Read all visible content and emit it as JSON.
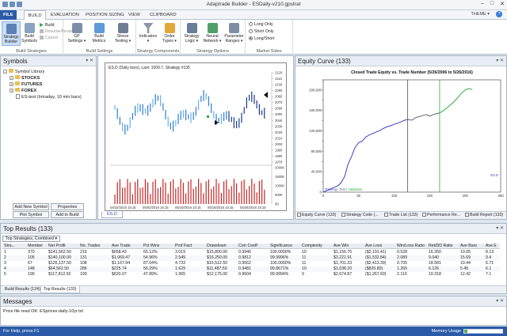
{
  "window": {
    "title": "Adaptrade Builder - ESDaily-v210.gpstrat",
    "theme_label": "THEME",
    "help": "?",
    "controls": [
      "–",
      "□",
      "✕"
    ]
  },
  "ribbon_tabs": [
    "FILE",
    "BUILD",
    "EVALUATION",
    "POSITION SIZING",
    "VIEW",
    "CLIPBOARD"
  ],
  "ribbon": {
    "strategy_builder": "Strategy Builder",
    "build_symbols": "Build Symbols",
    "build": "Build",
    "resume": "Resume/Iterate",
    "cancel": "Cancel",
    "group_build": "Build Strategies",
    "gp_settings": "GP Settings",
    "build_metrics": "Build Metrics",
    "stress_testing": "Stress Testing",
    "group_settings": "Build Settings",
    "indicators": "Indicators",
    "order_types": "Order Types",
    "group_components": "Strategy Components",
    "strategy_logic": "Strategy Logic",
    "neural_network": "Neural Network",
    "parameter_ranges": "Parameter Ranges",
    "group_options": "Strategy Options",
    "long_only": "Long Only",
    "short_only": "Short Only",
    "long_short": "Long/Short",
    "group_market": "Market Sides"
  },
  "symbols": {
    "title": "Symbols",
    "tree": [
      {
        "label": "Symbol Library",
        "kind": "folder",
        "level": 0,
        "exp": "-"
      },
      {
        "label": "STOCKS",
        "kind": "folder",
        "level": 1,
        "exp": "+"
      },
      {
        "label": "FUTURES",
        "kind": "folder",
        "level": 1,
        "exp": "+"
      },
      {
        "label": "FOREX",
        "kind": "folder",
        "level": 1,
        "exp": "+"
      },
      {
        "label": "ES-test (Intraday, 10 min bars)",
        "kind": "doc",
        "level": 1,
        "exp": ""
      }
    ],
    "buttons": {
      "add_new": "Add New Symbol",
      "properties": "Properties",
      "plot": "Plot Symbol",
      "add_build": "Add to Build"
    }
  },
  "price_chart": {
    "header": "ES.D (Daily bars), Last: 1009.7, Strategy #135",
    "price_ticks": [
      "2120",
      "2110",
      "2100",
      "2090",
      "2080",
      "2070",
      "2060",
      "2050",
      "2040",
      "2030",
      "2020",
      "2010",
      "2000",
      "1990",
      "1980",
      "1970"
    ],
    "volume_ticks": [
      "2000K",
      "1500K",
      "1000K",
      "500K",
      "0K"
    ],
    "dates": [
      "04/22/2016 15:15",
      "05/02/2016 15:15",
      "05/10/2016 15:15",
      "05/18/2016 15:15",
      "05/26/2016 15:15"
    ],
    "tab": "ES.D",
    "accent": "#1e90ff",
    "bar_color": "#c62828"
  },
  "equity": {
    "title": "Equity Curve (133)",
    "chart_title": "Closed Trade Equity vs. Trade Number (5/26/2006 to 5/26/2016)",
    "symbol_label": "ES.D",
    "legend": {
      "training": "Training",
      "test": "Test",
      "validation": "Validation"
    },
    "tabs": [
      "Equity Curve (133)",
      "Strategy Code (...",
      "Trade List (133)",
      "Performance Re...",
      "Build Report (133)"
    ]
  },
  "chart_data": {
    "type": "line",
    "title": "Closed Trade Equity vs. Trade Number (5/26/2006 to 5/26/2016)",
    "xlabel": "",
    "ylabel": "",
    "xlim": [
      0,
      250
    ],
    "ylim": [
      0,
      220000
    ],
    "x_ticks": [
      0,
      50,
      100,
      150,
      200,
      250
    ],
    "y_ticks": [
      0,
      20000,
      40000,
      60000,
      80000,
      100000,
      120000,
      140000,
      160000,
      180000,
      200000,
      220000
    ],
    "y_tick_labels": [
      "0",
      "20,000",
      "40,000",
      "60,000",
      "80,000",
      "100,000",
      "120,000",
      "140,000",
      "160,000",
      "180,000",
      "200,000",
      "220,000"
    ],
    "markers": {
      "test_start": 119,
      "validation_start": 164
    },
    "series": [
      {
        "name": "Training",
        "color": "#3f3fbf",
        "x": [
          0,
          5,
          10,
          15,
          20,
          25,
          30,
          35,
          40,
          45,
          50,
          55,
          60,
          65,
          70,
          75,
          80,
          85,
          90,
          95,
          100,
          105,
          110,
          115,
          119
        ],
        "y": [
          0,
          3000,
          6000,
          9000,
          12000,
          18000,
          30000,
          55000,
          70000,
          88000,
          97000,
          100000,
          108000,
          112000,
          115000,
          118000,
          121000,
          125000,
          128000,
          130000,
          133000,
          135000,
          138000,
          141000,
          142000
        ]
      },
      {
        "name": "Test",
        "color": "#666666",
        "x": [
          119,
          125,
          130,
          135,
          140,
          145,
          150,
          155,
          160,
          164
        ],
        "y": [
          142000,
          141000,
          146000,
          148000,
          150000,
          152000,
          149000,
          152000,
          154000,
          155000
        ]
      },
      {
        "name": "Validation",
        "color": "#2eaa3c",
        "x": [
          164,
          170,
          175,
          180,
          185,
          190,
          195,
          200,
          205,
          210
        ],
        "y": [
          155000,
          160000,
          166000,
          172000,
          178000,
          186000,
          194000,
          200000,
          203000,
          201000
        ]
      }
    ]
  },
  "results": {
    "title": "Top Results (133)",
    "dropdown": "Top Strategies, Combined",
    "columns": [
      "Stra...",
      "Member",
      "Net Profit",
      "No. Trades",
      "Ave Trade",
      "Pct Wins",
      "Prof Fact",
      "Drawdown",
      "Corr Coeff",
      "Significance",
      "Complexity",
      "Ave Win",
      "Ave Loss",
      "Win/Loss Ratio",
      "Ret/DD Ratio",
      "Ave Bars",
      "Ave E"
    ],
    "rows": [
      [
        "1",
        "370",
        "$141,562.50",
        "215",
        "$658.43",
        "65.12%",
        "3.019",
        "$15,800.00",
        "0.9946",
        "100.0000%",
        "10",
        "$1,156.76",
        "($2,191.41)",
        "0.528",
        "16.350",
        "10.05",
        "8.13"
      ],
      [
        "2",
        "105",
        "$140,100.00",
        "131",
        "$1,069.47",
        "54.96%",
        "2.549",
        "$16,250.00",
        "0.9812",
        "99.9996%",
        "11",
        "$3,221.91",
        "($1,532.84)",
        "2.089",
        "9.040",
        "15.69",
        "9.4"
      ],
      [
        "3",
        "67",
        "$126,137.50",
        "108",
        "$1,167.94",
        "87.04%",
        "4.733",
        "$15,512.50",
        "0.9562",
        "100.0000%",
        "11",
        "$1,701.33",
        "($2,413.39)",
        "0.705",
        "18.581",
        "19.44",
        "6.71"
      ],
      [
        "4",
        "148",
        "$64,562.50",
        "286",
        "$225.74",
        "56.29%",
        "1.629",
        "$11,487.50",
        "0.9481",
        "99.8671%",
        "10",
        "$1,038.20",
        "($820.80)",
        "1.265",
        "6.126",
        "5.45",
        "6.1"
      ],
      [
        "5",
        "199",
        "$117,812.50",
        "190",
        "$620.07",
        "47.89%",
        "1.965",
        "$12,175.00",
        "0.9604",
        "99.9994%",
        "9",
        "$2,674.87",
        "($1,267.60)",
        "2.110",
        "10.318",
        "12.42",
        "7.1"
      ]
    ],
    "tabs": [
      "Build Results (124)",
      "Top Results (133)"
    ]
  },
  "messages": {
    "title": "Messages",
    "text": "Price file read OK: ESprices-daily-10yr.txt"
  },
  "status": {
    "left": "For Help, press F1",
    "memory": "Memory Usage",
    "memory_fraction": 0.08
  }
}
